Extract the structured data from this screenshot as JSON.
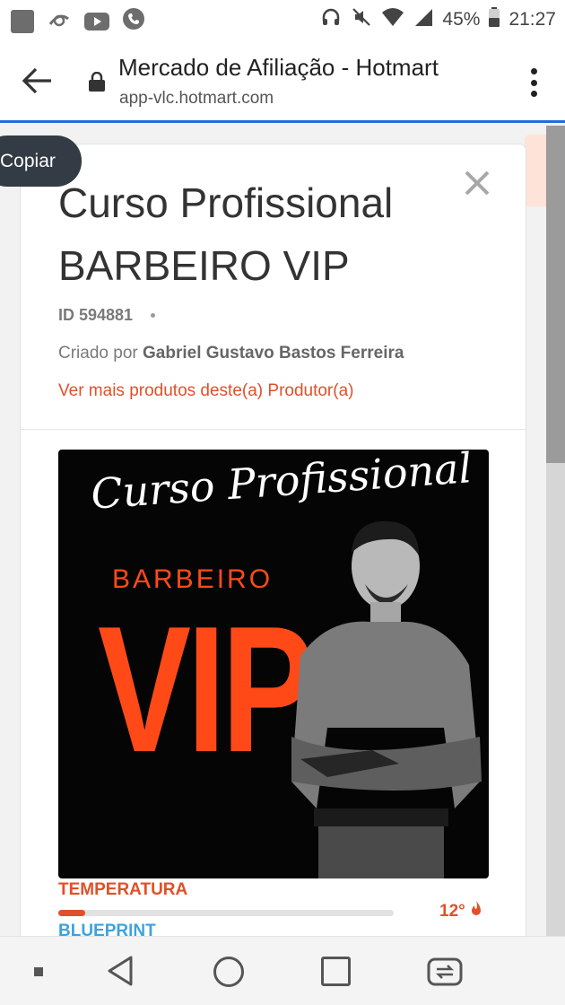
{
  "status_bar": {
    "battery": "45%",
    "time": "21:27",
    "left_icons": [
      "gallery-icon",
      "carrier-icon",
      "youtube-icon",
      "phone-icon"
    ],
    "right_icons": [
      "headset-icon",
      "mute-icon",
      "wifi-icon",
      "signal-icon",
      "battery-icon"
    ]
  },
  "browser": {
    "page_title": "Mercado de Afiliação - Hotmart",
    "url": "app-vlc.hotmart.com"
  },
  "tooltip": {
    "label": "Copiar"
  },
  "product": {
    "title_line1": "Curso Profissional",
    "title_line2": "BARBEIRO VIP",
    "id_label": "ID 594881",
    "created_by_label": "Criado por",
    "creator_name": "Gabriel Gustavo Bastos Ferreira",
    "more_products_link": "Ver mais produtos deste(a) Produtor(a)"
  },
  "product_image": {
    "script_text": "Curso Profissional",
    "word_barbeiro": "BARBEIRO",
    "word_vip": "VIP"
  },
  "temperature": {
    "label": "TEMPERATURA",
    "value": "12°",
    "fill_percent": 8,
    "color": "#e0502a"
  },
  "blueprint": {
    "label": "BLUEPRINT"
  },
  "colors": {
    "accent": "#e0502a",
    "blueprint": "#3fa2dc",
    "progress": "#1e6fd9",
    "tooltip_bg": "#333b45"
  }
}
